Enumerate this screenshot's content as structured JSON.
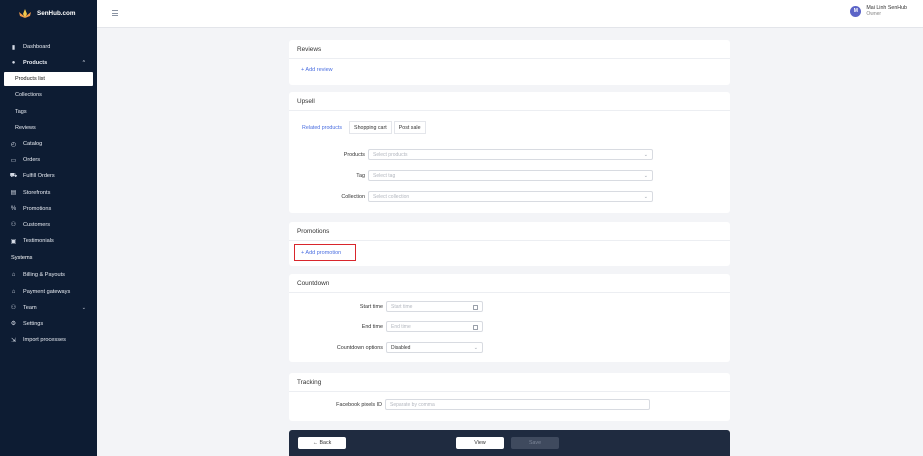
{
  "brand": {
    "name": "SenHub.com"
  },
  "sidebar": {
    "items": [
      {
        "label": "Dashboard",
        "icon": "bar-chart-icon"
      },
      {
        "label": "Products",
        "icon": "box-icon",
        "expanded": true
      },
      {
        "label": "Products list",
        "sub": true,
        "active": true
      },
      {
        "label": "Collections",
        "sub": true
      },
      {
        "label": "Tags",
        "sub": true
      },
      {
        "label": "Reviews",
        "sub": true
      },
      {
        "label": "Catalog",
        "icon": "catalog-icon"
      },
      {
        "label": "Orders",
        "icon": "orders-icon"
      },
      {
        "label": "Fulfill Orders",
        "icon": "fulfill-icon"
      },
      {
        "label": "Storefronts",
        "icon": "storefront-icon"
      },
      {
        "label": "Promotions",
        "icon": "percent-icon"
      },
      {
        "label": "Customers",
        "icon": "customers-icon"
      },
      {
        "label": "Testimonials",
        "icon": "testimonial-icon"
      }
    ],
    "section_label": "Systems",
    "system_items": [
      {
        "label": "Billing & Payouts",
        "icon": "bank-icon"
      },
      {
        "label": "Payment gateways",
        "icon": "bank-icon"
      },
      {
        "label": "Team",
        "icon": "team-icon"
      },
      {
        "label": "Settings",
        "icon": "settings-icon"
      },
      {
        "label": "Import processes",
        "icon": "import-icon"
      }
    ]
  },
  "header": {
    "user": {
      "initial": "M",
      "name": "Mai Linh SenHub",
      "role": "Owner"
    }
  },
  "reviews": {
    "title": "Reviews",
    "add_label": "+ Add review"
  },
  "upsell": {
    "title": "Upsell",
    "tabs": [
      "Related products",
      "Shopping cart",
      "Post sale"
    ],
    "fields": [
      {
        "label": "Products",
        "placeholder": "Select products"
      },
      {
        "label": "Tag",
        "placeholder": "Select tag"
      },
      {
        "label": "Collection",
        "placeholder": "Select collection"
      }
    ]
  },
  "promotions": {
    "title": "Promotions",
    "add_label": "+ Add promotion"
  },
  "countdown": {
    "title": "Countdown",
    "start_label": "Start time",
    "start_placeholder": "Start time",
    "end_label": "End time",
    "end_placeholder": "End time",
    "options_label": "Countdown options",
    "options_value": "Disabled"
  },
  "tracking": {
    "title": "Tracking",
    "pixel_label": "Facebook pixels ID",
    "pixel_placeholder": "Separate by comma"
  },
  "actions": {
    "back": "← Back",
    "view": "View",
    "save": "Save"
  },
  "colors": {
    "sidebar": "#0d1c33",
    "accent": "#4a6ee0",
    "highlight": "#d9262c"
  }
}
